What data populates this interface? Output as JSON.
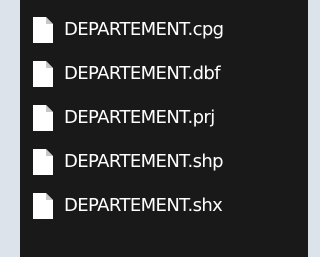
{
  "files": [
    {
      "name": "DEPARTEMENT.cpg",
      "icon": "file-icon"
    },
    {
      "name": "DEPARTEMENT.dbf",
      "icon": "file-icon"
    },
    {
      "name": "DEPARTEMENT.prj",
      "icon": "file-icon"
    },
    {
      "name": "DEPARTEMENT.shp",
      "icon": "file-icon"
    },
    {
      "name": "DEPARTEMENT.shx",
      "icon": "file-icon"
    }
  ],
  "colors": {
    "background": "#191919",
    "text": "#ffffff",
    "icon_fill": "#ffffff",
    "icon_fold": "#c8c8c8",
    "outer_background": "#dde3ea"
  }
}
